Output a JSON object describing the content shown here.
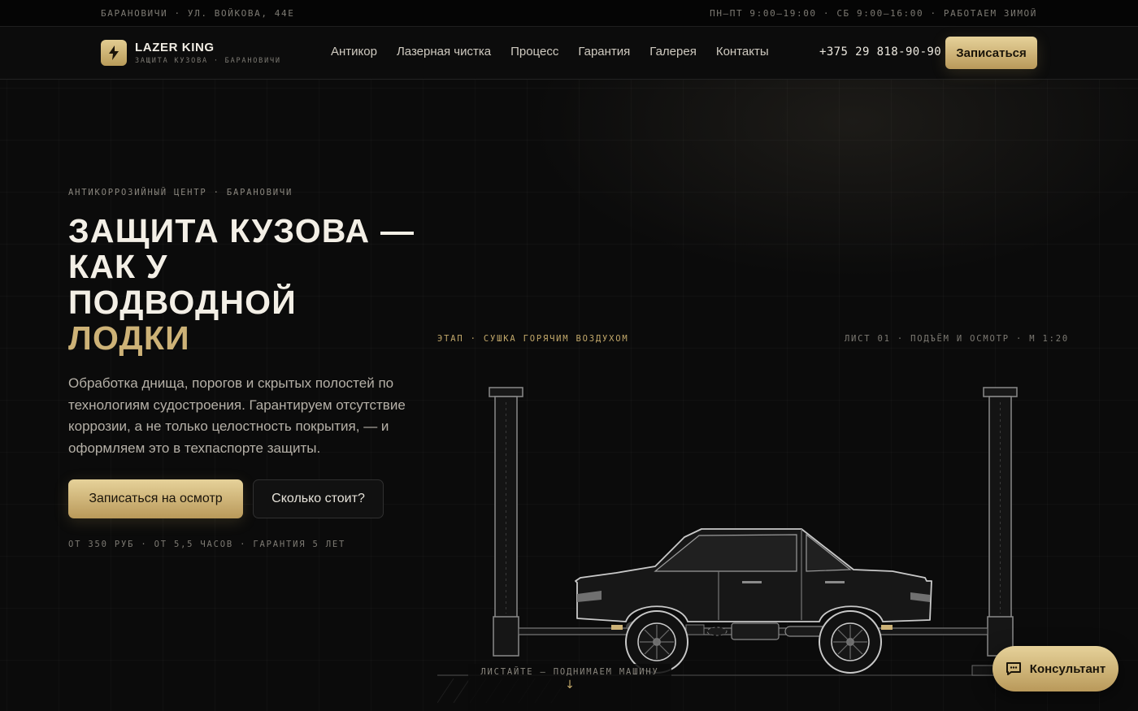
{
  "topbar": {
    "address": "БАРАНОВИЧИ · УЛ. ВОЙКОВА, 44Е",
    "hours": "ПН–ПТ 9:00–19:00 · СБ 9:00–16:00 · РАБОТАЕМ ЗИМОЙ"
  },
  "header": {
    "brand": "LAZER KING",
    "brand_sub": "ЗАЩИТА КУЗОВА · БАРАНОВИЧИ",
    "nav": [
      "Антикор",
      "Лазерная чистка",
      "Процесс",
      "Гарантия",
      "Галерея",
      "Контакты"
    ],
    "phone": "+375 29 818-90-90",
    "cta": "Записаться"
  },
  "hero": {
    "eyebrow": "АНТИКОРРОЗИЙНЫЙ ЦЕНТР · БАРАНОВИЧИ",
    "title_lines": [
      "ЗАЩИТА КУЗОВА —",
      "КАК У",
      "ПОДВОДНОЙ"
    ],
    "title_accent": "ЛОДКИ",
    "description": "Обработка днища, порогов и скрытых полостей по технологиям судостроения. Гарантируем отсутствие коррозии, а не только целостность покрытия, — и оформляем это в техпаспорте защиты.",
    "primary_cta": "Записаться на осмотр",
    "secondary_cta": "Сколько стоит?",
    "stats": "ОТ 350 РУБ · ОТ 5,5 ЧАСОВ · ГАРАНТИЯ 5 ЛЕТ"
  },
  "illustration": {
    "stage": "ЭТАП · СУШКА ГОРЯЧИМ ВОЗДУХОМ",
    "sheet": "ЛИСТ 01 · ПОДЪЁМ И ОСМОТР · М 1:20",
    "scroll_hint": "ЛИСТАЙТЕ — ПОДНИМАЕМ МАШИНУ",
    "scroll_arrow": "↓"
  },
  "consultant": {
    "label": "Консультант"
  },
  "colors": {
    "gold": "#cdb277",
    "background": "#0b0b0b",
    "accent_gold_dark": "#b9995a"
  }
}
